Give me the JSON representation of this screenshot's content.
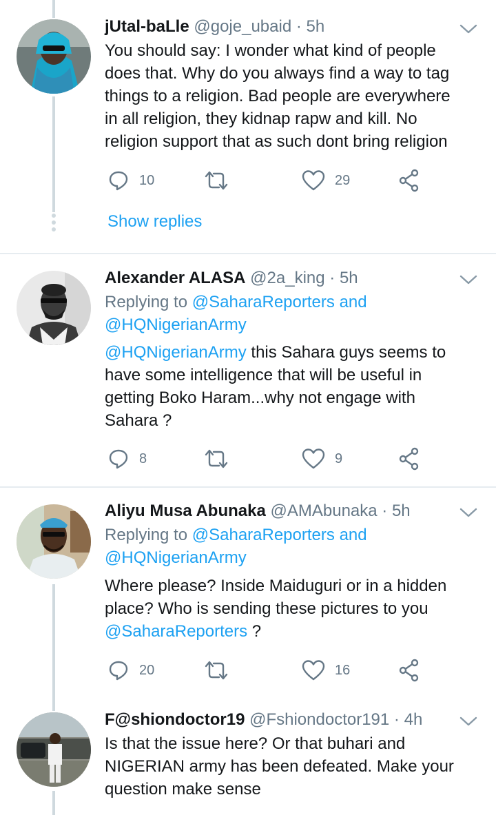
{
  "tweets": [
    {
      "name": "jUtal-baLle",
      "handle": "@goje_ubaid",
      "time": "5h",
      "lines": [
        "You should say: I wonder what kind of people",
        "does that. Why do you always find a way to tag",
        "things to a religion. Bad people are everywhere",
        "in all religion, they kidnap rapw and kill. No",
        "religion support that as such dont bring religion"
      ],
      "replies": "10",
      "retweets": "",
      "likes": "29",
      "show_replies": "Show replies"
    },
    {
      "name": "Alexander ALASA",
      "handle": "@2a_king",
      "time": "5h",
      "replying_prefix": "Replying to",
      "replying_to_1": "@SaharaReporters",
      "replying_and": "and",
      "replying_to_2": "@HQNigerianArmy",
      "mention": "@HQNigerianArmy",
      "line1_rest": " this Sahara guys seems to",
      "lines": [
        "have some intelligence that will be useful in",
        "getting Boko Haram...why not engage with",
        "Sahara ?"
      ],
      "replies": "8",
      "likes": "9"
    },
    {
      "name": "Aliyu Musa Abunaka",
      "handle": "@AMAbunaka",
      "time": "5h",
      "replying_prefix": "Replying to",
      "replying_to_1": "@SaharaReporters",
      "replying_and": "and",
      "replying_to_2": "@HQNigerianArmy",
      "lines": [
        "Where please? Inside Maiduguri or in a hidden",
        "place? Who is sending these pictures to you"
      ],
      "mention": "@SaharaReporters",
      "mention_rest": " ?",
      "replies": "20",
      "likes": "16"
    },
    {
      "name": "F@shiondoctor19",
      "handle": "@Fshiondoctor191",
      "time": "4h",
      "lines": [
        "Is that the issue here? Or that buhari and",
        "NIGERIAN army has been defeated. Make your",
        "question make sense"
      ]
    }
  ],
  "separator": "·",
  "colors": {
    "link": "#1da1f2",
    "muted": "#657786",
    "text": "#14171a",
    "line": "#cfd9de"
  }
}
